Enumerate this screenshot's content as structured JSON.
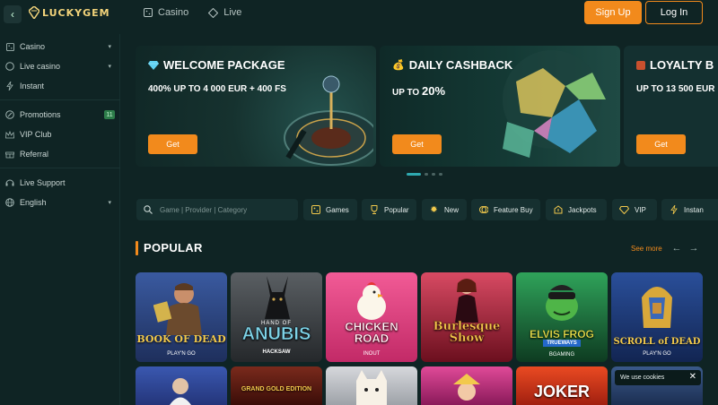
{
  "header": {
    "logo_text": "LUCKYGEM",
    "nav": [
      {
        "label": "Casino",
        "icon": "casino-icon"
      },
      {
        "label": "Live",
        "icon": "live-icon"
      }
    ],
    "signup_label": "Sign Up",
    "login_label": "Log In"
  },
  "sidebar": {
    "items": [
      {
        "label": "Casino",
        "icon": "casino-icon",
        "has_chevron": true
      },
      {
        "label": "Live casino",
        "icon": "live-casino-icon",
        "has_chevron": true
      },
      {
        "label": "Instant",
        "icon": "lightning-icon"
      },
      {
        "label": "Promotions",
        "icon": "promotions-icon",
        "badge": "11"
      },
      {
        "label": "VIP Club",
        "icon": "crown-icon"
      },
      {
        "label": "Referral",
        "icon": "referral-icon"
      },
      {
        "label": "Live Support",
        "icon": "support-icon"
      },
      {
        "label": "English",
        "icon": "globe-icon",
        "has_chevron": true
      }
    ]
  },
  "banners": [
    {
      "title": "WELCOME PACKAGE",
      "icon": "diamond-icon",
      "subtitle": "400% UP TO 4 000 EUR + 400 FS",
      "button": "Get"
    },
    {
      "title": "DAILY CASHBACK",
      "icon": "money-bag-icon",
      "subtitle": "UP TO 20%",
      "button": "Get"
    },
    {
      "title": "LOYALTY B",
      "icon": "gift-icon",
      "subtitle": "UP TO 13 500 EUR",
      "button": "Get"
    }
  ],
  "search": {
    "placeholder": "Game | Provider | Category"
  },
  "categories": [
    {
      "label": "Games",
      "icon": "games-icon"
    },
    {
      "label": "Popular",
      "icon": "trophy-icon"
    },
    {
      "label": "New",
      "icon": "new-icon"
    },
    {
      "label": "Feature Buy",
      "icon": "feature-buy-icon"
    },
    {
      "label": "Jackpots",
      "icon": "jackpot-icon"
    },
    {
      "label": "VIP",
      "icon": "vip-icon"
    },
    {
      "label": "Instan",
      "icon": "lightning-icon"
    }
  ],
  "popular": {
    "title": "POPULAR",
    "see_more": "See more",
    "games_row1": [
      {
        "name": "BOOK OF DEAD",
        "provider": "PLAY'N GO",
        "bg": "#2b3f77"
      },
      {
        "name": "ANUBIS",
        "top": "HAND OF",
        "provider": "HACKSAW",
        "bg": "#3a3d40"
      },
      {
        "name": "CHICKEN ROAD",
        "provider": "INOUT",
        "bg": "#d83a78"
      },
      {
        "name": "Burlesque Show",
        "provider": "",
        "bg": "#8a1a2c"
      },
      {
        "name": "ELVIS FROG",
        "sub": "TRUEWAYS",
        "provider": "BGAMING",
        "bg": "#1c6a3a"
      },
      {
        "name": "SCROLL of DEAD",
        "provider": "PLAY'N GO",
        "bg": "#1f3a78"
      }
    ],
    "games_row2": [
      {
        "name": "",
        "bg": "#2a3f84"
      },
      {
        "name": "GRAND GOLD EDITION",
        "bg": "#5c1b14"
      },
      {
        "name": "",
        "bg": "#c4c7cc"
      },
      {
        "name": "",
        "bg": "#c0307a"
      },
      {
        "name": "JOKER",
        "bg": "#e04020"
      },
      {
        "name": "",
        "bg": "#2c4a7a"
      }
    ]
  },
  "cookie": {
    "text": "We use cookies"
  }
}
